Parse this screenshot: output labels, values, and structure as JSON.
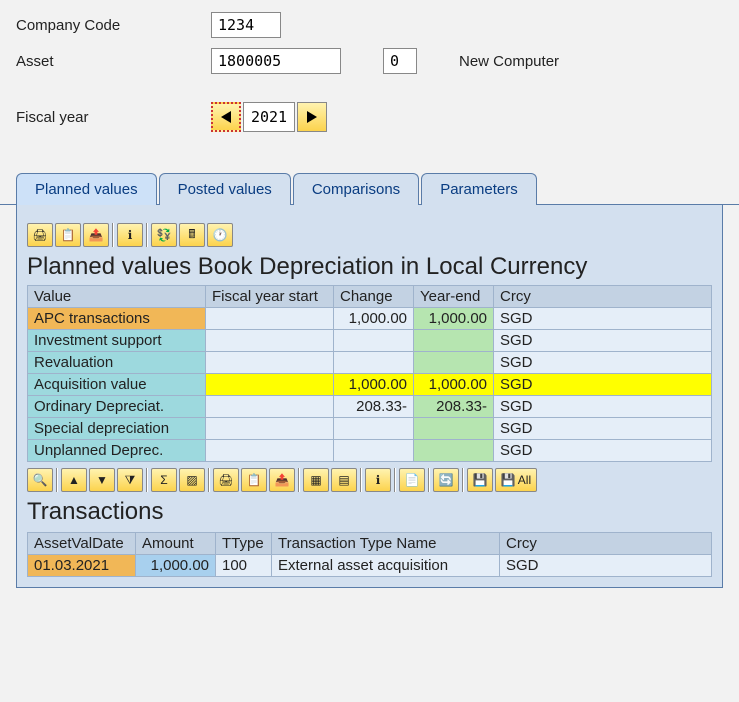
{
  "header": {
    "companyCodeLabel": "Company Code",
    "companyCode": "1234",
    "assetLabel": "Asset",
    "asset": "1800005",
    "assetSub": "0",
    "assetDesc": "New Computer",
    "fiscalYearLabel": "Fiscal year",
    "fiscalYear": "2021"
  },
  "tabs": [
    "Planned values",
    "Posted values",
    "Comparisons",
    "Parameters"
  ],
  "plannedTitle": "Planned values Book Depreciation in Local Currency",
  "plannedHeaders": {
    "value": "Value",
    "fyStart": "Fiscal year start",
    "change": "Change",
    "yearEnd": "Year-end",
    "crcy": "Crcy"
  },
  "plannedRows": [
    {
      "label": "APC transactions",
      "labelClass": "cell-orange",
      "fyStart": "",
      "change": "1,000.00",
      "yearEnd": "1,000.00",
      "yearEndClass": "cell-green",
      "crcy": "SGD",
      "crcyClass": ""
    },
    {
      "label": "Investment support",
      "labelClass": "cell-teal",
      "fyStart": "",
      "change": "",
      "yearEnd": "",
      "yearEndClass": "cell-green",
      "crcy": "SGD",
      "crcyClass": ""
    },
    {
      "label": "Revaluation",
      "labelClass": "cell-teal",
      "fyStart": "",
      "change": "",
      "yearEnd": "",
      "yearEndClass": "cell-green",
      "crcy": "SGD",
      "crcyClass": ""
    },
    {
      "label": "Acquisition value",
      "labelClass": "cell-teal",
      "fyStart": "",
      "fyStartClass": "cell-yellow",
      "change": "1,000.00",
      "changeClass": "cell-yellow",
      "yearEnd": "1,000.00",
      "yearEndClass": "cell-yellow",
      "crcy": "SGD",
      "crcyClass": "cell-yellow"
    },
    {
      "label": "Ordinary Depreciat.",
      "labelClass": "cell-teal",
      "fyStart": "",
      "change": "208.33-",
      "yearEnd": "208.33-",
      "yearEndClass": "cell-green",
      "crcy": "SGD",
      "crcyClass": ""
    },
    {
      "label": "Special depreciation",
      "labelClass": "cell-teal",
      "fyStart": "",
      "change": "",
      "yearEnd": "",
      "yearEndClass": "cell-green",
      "crcy": "SGD",
      "crcyClass": ""
    },
    {
      "label": "Unplanned Deprec.",
      "labelClass": "cell-teal",
      "fyStart": "",
      "change": "",
      "yearEnd": "",
      "yearEndClass": "cell-green",
      "crcy": "SGD",
      "crcyClass": ""
    }
  ],
  "txnTitle": "Transactions",
  "txnHeaders": {
    "date": "AssetValDate",
    "amount": "Amount",
    "ttype": "TType",
    "tname": "Transaction Type Name",
    "crcy": "Crcy"
  },
  "txnRows": [
    {
      "date": "01.03.2021",
      "amount": "1,000.00",
      "ttype": "100",
      "tname": "External asset acquisition",
      "crcy": "SGD"
    }
  ],
  "toolbar2All": "All"
}
